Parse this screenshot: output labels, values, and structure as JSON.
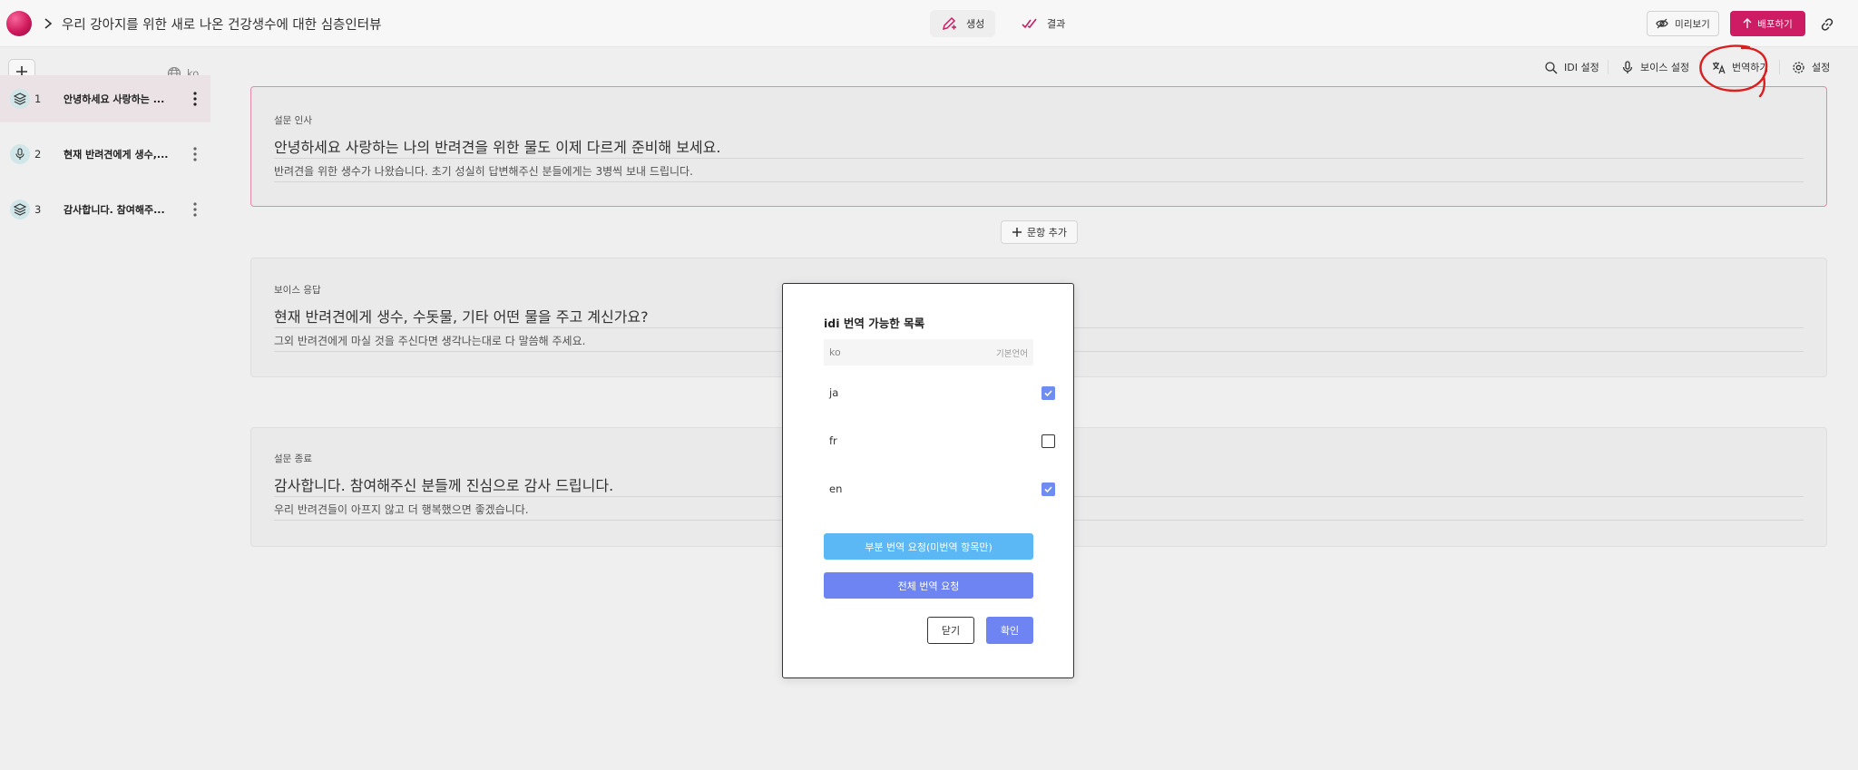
{
  "header": {
    "survey_title": "우리 강아지를 위한 새로 나온 건강생수에 대한 심층인터뷰",
    "tabs": [
      {
        "label": "생성",
        "active": true
      },
      {
        "label": "결과",
        "active": false
      }
    ],
    "preview_label": "미리보기",
    "deploy_label": "배포하기"
  },
  "sidebar": {
    "language": "ko",
    "items": [
      {
        "num": "1",
        "label": "안녕하세요 사랑하는 ...",
        "icon": "stack-icon"
      },
      {
        "num": "2",
        "label": "현재 반려견에게 생수,...",
        "icon": "microphone-icon"
      },
      {
        "num": "3",
        "label": "감사합니다. 참여해주...",
        "icon": "stack-icon"
      }
    ]
  },
  "toolbar": {
    "idi_settings": "IDI 설정",
    "voice_settings": "보이스 설정",
    "translate": "번역하기",
    "settings": "설정"
  },
  "cards": [
    {
      "type": "설문 인사",
      "title": "안녕하세요 사랑하는 나의 반려견을 위한 물도 이제 다르게 준비해 보세요.",
      "desc": "반려견을 위한 생수가 나왔습니다. 초기 성실히 답변해주신 분들에게는 3병씩 보내 드립니다."
    },
    {
      "type": "보이스 응답",
      "title": "현재 반려견에게 생수, 수돗물, 기타 어떤 물을 주고 계신가요?",
      "desc": "그외 반려견에게 마실 것을 주신다면 생각나는대로 다 말씀해 주세요."
    },
    {
      "type": "설문 종료",
      "title": "감사합니다. 참여해주신 분들께 진심으로 감사 드립니다.",
      "desc": "우리 반려견들이 아프지 않고 더 행복했으면 좋겠습니다."
    }
  ],
  "add_item_label": "문항 추가",
  "modal": {
    "title": "idi 번역 가능한 목록",
    "base_language": "ko",
    "base_tag": "기본언어",
    "languages": [
      {
        "code": "ja",
        "checked": true
      },
      {
        "code": "fr",
        "checked": false
      },
      {
        "code": "en",
        "checked": true
      }
    ],
    "partial_label": "부분 번역 요청(미번역 항목만)",
    "full_label": "전체 번역 요청",
    "close_label": "닫기",
    "confirm_label": "확인"
  },
  "colors": {
    "brand": "#d51d68",
    "accent_blue": "#6d84f2",
    "light_blue": "#5cb8f5",
    "annotation_red": "#e02020"
  }
}
